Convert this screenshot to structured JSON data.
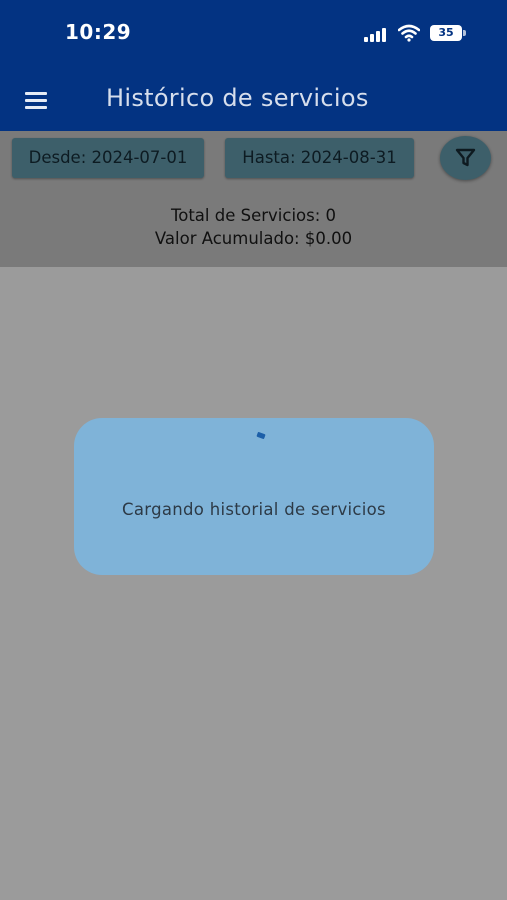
{
  "status_bar": {
    "time": "10:29",
    "battery": "35"
  },
  "header": {
    "title": "Histórico de servicios",
    "menu_icon": "hamburger-menu-icon",
    "background_color": "#033382"
  },
  "filters": {
    "from_label": "Desde: 2024-07-01",
    "to_label": "Hasta: 2024-08-31",
    "filter_icon": "funnel-filter-icon"
  },
  "summary": {
    "total_services": "Total de Servicios: 0",
    "accumulated_value": "Valor Acumulado: $0.00"
  },
  "loading_dialog": {
    "message": "Cargando historial de servicios",
    "background_color": "#7fb3d8"
  }
}
